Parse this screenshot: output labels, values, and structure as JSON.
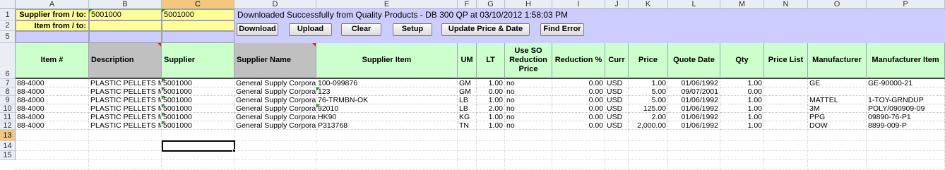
{
  "columns": [
    "A",
    "B",
    "C",
    "D",
    "E",
    "F",
    "G",
    "H",
    "I",
    "J",
    "K",
    "L",
    "M",
    "N",
    "O",
    "P"
  ],
  "selected_column": "C",
  "rows": [
    "1",
    "2",
    "5",
    "6",
    "7",
    "8",
    "9",
    "10",
    "11",
    "12",
    "13",
    "14",
    "15"
  ],
  "selected_row": "13",
  "controls": {
    "supplier_label": "Supplier from / to:",
    "supplier_from": "5001000",
    "supplier_to": "5001000",
    "item_label": "Item from / to:",
    "status": "Downloaded Successfully from Quality Products - DB 300 QP at 03/10/2012 1:58:03 PM"
  },
  "buttons": {
    "download": "Download",
    "upload": "Upload",
    "clear": "Clear",
    "setup": "Setup",
    "update": "Update Price & Date",
    "find_error": "Find Error"
  },
  "headers": [
    "Item #",
    "Description",
    "Supplier",
    "Supplier Name",
    "Supplier Item",
    "UM",
    "LT",
    "Use SO Reduction Price",
    "Reduction %",
    "Curr",
    "Price",
    "Quote Date",
    "Qty",
    "Price List",
    "Manufacturer",
    "Manufacturer Item"
  ],
  "data_rows": [
    {
      "item": "88-4000",
      "desc": "PLASTIC PELLETS M",
      "supplier": "5001000",
      "name": "General Supply Corpora",
      "sitem": "100-099876",
      "um": "GM",
      "lt": "1.00",
      "useso": "no",
      "red": "0.00",
      "curr": "USD",
      "price": "1.00",
      "date": "01/06/1992",
      "qty": "1.00",
      "plist": "",
      "mfr": "GE",
      "mitem": "GE-90000-21"
    },
    {
      "item": "88-4000",
      "desc": "PLASTIC PELLETS M",
      "supplier": "5001000",
      "name": "General Supply Corpora",
      "sitem": "123",
      "um": "GM",
      "lt": "0.00",
      "useso": "no",
      "red": "0.00",
      "curr": "USD",
      "price": "5.00",
      "date": "09/07/2001",
      "qty": "0.00",
      "plist": "",
      "mfr": "",
      "mitem": ""
    },
    {
      "item": "88-4000",
      "desc": "PLASTIC PELLETS M",
      "supplier": "5001000",
      "name": "General Supply Corpora",
      "sitem": "76-TRMBN-OK",
      "um": "LB",
      "lt": "1.00",
      "useso": "no",
      "red": "0.00",
      "curr": "USD",
      "price": "5.00",
      "date": "01/06/1992",
      "qty": "1.00",
      "plist": "",
      "mfr": "MATTEL",
      "mitem": "1-TOY-GRNDUP"
    },
    {
      "item": "88-4000",
      "desc": "PLASTIC PELLETS M",
      "supplier": "5001000",
      "name": "General Supply Corpora",
      "sitem": "92010",
      "um": "LB",
      "lt": "2.00",
      "useso": "no",
      "red": "0.00",
      "curr": "USD",
      "price": "125.00",
      "date": "01/06/1992",
      "qty": "1.00",
      "plist": "",
      "mfr": "3M",
      "mitem": "POLY/090909-09"
    },
    {
      "item": "88-4000",
      "desc": "PLASTIC PELLETS M",
      "supplier": "5001000",
      "name": "General Supply Corpora",
      "sitem": "HK90",
      "um": "KG",
      "lt": "1.00",
      "useso": "no",
      "red": "0.00",
      "curr": "USD",
      "price": "2.00",
      "date": "01/06/1992",
      "qty": "1.00",
      "plist": "",
      "mfr": "PPG",
      "mitem": "09890-76-P1"
    },
    {
      "item": "88-4000",
      "desc": "PLASTIC PELLETS M",
      "supplier": "5001000",
      "name": "General Supply Corpora",
      "sitem": "P313768",
      "um": "TN",
      "lt": "1.00",
      "useso": "no",
      "red": "0.00",
      "curr": "USD",
      "price": "2,000.00",
      "date": "01/06/1992",
      "qty": "1.00",
      "plist": "",
      "mfr": "DOW",
      "mitem": "8899-009-P"
    }
  ]
}
